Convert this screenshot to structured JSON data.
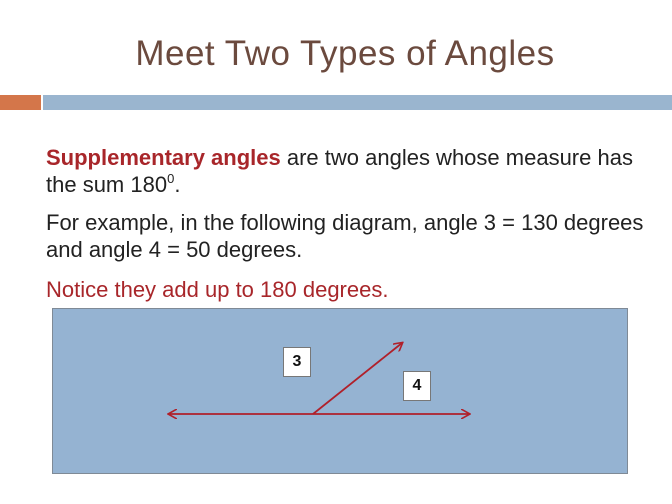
{
  "slide": {
    "title": "Meet Two Types of Angles",
    "paragraph1": {
      "term": "Supplementary angles",
      "text_before_sup": " are two angles whose measure has the sum 180",
      "superscript": "0",
      "text_after_sup": "."
    },
    "paragraph2": "For example, in the following diagram, angle 3 = 130 degrees and angle 4 = 50 degrees.",
    "paragraph3": "Notice they add up to 180 degrees.",
    "diagram": {
      "angle_label_3": "3",
      "angle_label_4": "4"
    },
    "colors": {
      "title": "#6b4a3e",
      "accent_red": "#a8262a",
      "orange_bar": "#d4764a",
      "blue_bar": "#9ab5cf",
      "diagram_bg": "#95b3d2"
    }
  }
}
